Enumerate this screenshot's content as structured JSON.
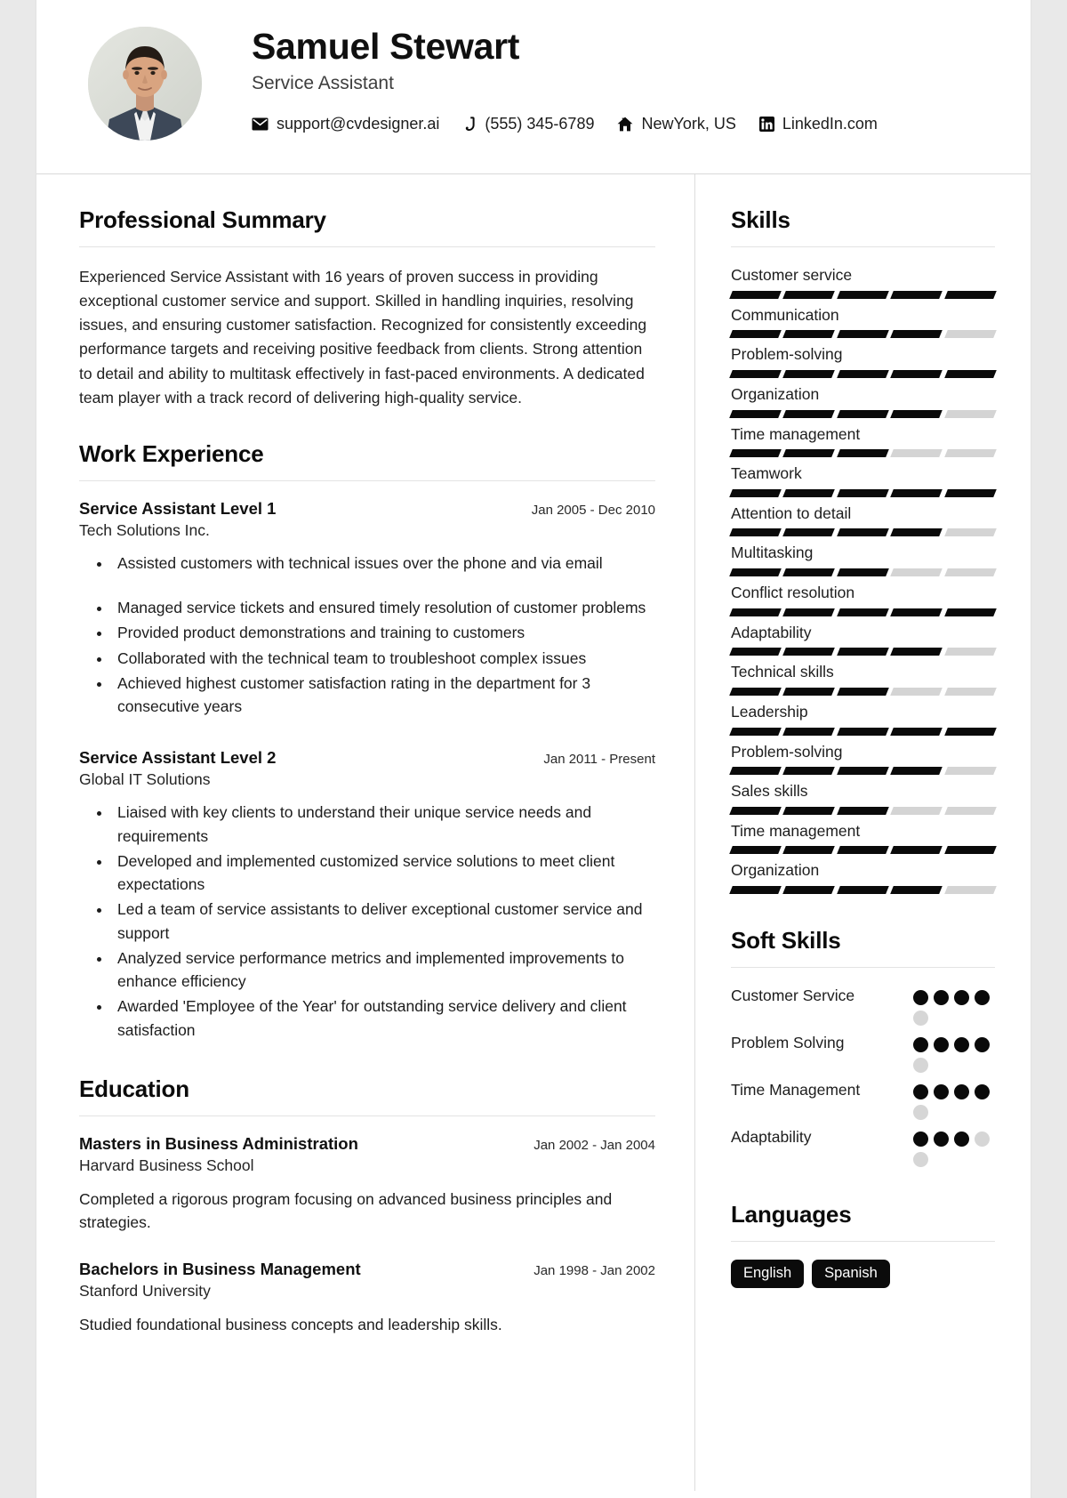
{
  "header": {
    "name": "Samuel Stewart",
    "title": "Service Assistant",
    "contacts": [
      {
        "icon": "email-icon",
        "text": "support@cvdesigner.ai"
      },
      {
        "icon": "phone-icon",
        "text": "(555) 345-6789"
      },
      {
        "icon": "home-icon",
        "text": "NewYork, US"
      },
      {
        "icon": "linkedin-icon",
        "text": "LinkedIn.com"
      }
    ]
  },
  "main": {
    "summary": {
      "heading": "Professional Summary",
      "text": "Experienced Service Assistant with 16 years of proven success in providing exceptional customer service and support. Skilled in handling inquiries, resolving issues, and ensuring customer satisfaction. Recognized for consistently exceeding performance targets and receiving positive feedback from clients. Strong attention to detail and ability to multitask effectively in fast-paced environments. A dedicated team player with a track record of delivering high-quality service."
    },
    "work": {
      "heading": "Work Experience",
      "jobs": [
        {
          "role": "Service Assistant Level 1",
          "org": "Tech Solutions Inc.",
          "date": "Jan 2005 - Dec 2010",
          "bullets": [
            "Assisted customers with technical issues over the phone and via email",
            "Managed service tickets and ensured timely resolution of customer problems",
            "Provided product demonstrations and training to customers",
            "Collaborated with the technical team to troubleshoot complex issues",
            "Achieved highest customer satisfaction rating in the department for 3 consecutive years"
          ]
        },
        {
          "role": "Service Assistant Level 2",
          "org": "Global IT Solutions",
          "date": "Jan 2011 - Present",
          "bullets": [
            "Liaised with key clients to understand their unique service needs and requirements",
            "Developed and implemented customized service solutions to meet client expectations",
            "Led a team of service assistants to deliver exceptional customer service and support",
            "Analyzed service performance metrics and implemented improvements to enhance efficiency",
            "Awarded 'Employee of the Year' for outstanding service delivery and client satisfaction"
          ]
        }
      ]
    },
    "education": {
      "heading": "Education",
      "items": [
        {
          "degree": "Masters in Business Administration",
          "school": "Harvard Business School",
          "date": "Jan 2002 - Jan 2004",
          "desc": "Completed a rigorous program focusing on advanced business principles and strategies."
        },
        {
          "degree": "Bachelors in Business Management",
          "school": "Stanford University",
          "date": "Jan 1998 - Jan 2002",
          "desc": "Studied foundational business concepts and leadership skills."
        }
      ]
    }
  },
  "sidebar": {
    "skills": {
      "heading": "Skills",
      "max": 5,
      "items": [
        {
          "label": "Customer service",
          "level": 5
        },
        {
          "label": "Communication",
          "level": 4
        },
        {
          "label": "Problem-solving",
          "level": 5
        },
        {
          "label": "Organization",
          "level": 4
        },
        {
          "label": "Time management",
          "level": 3
        },
        {
          "label": "Teamwork",
          "level": 5
        },
        {
          "label": "Attention to detail",
          "level": 4
        },
        {
          "label": "Multitasking",
          "level": 3
        },
        {
          "label": "Conflict resolution",
          "level": 5
        },
        {
          "label": "Adaptability",
          "level": 4
        },
        {
          "label": "Technical skills",
          "level": 3
        },
        {
          "label": "Leadership",
          "level": 5
        },
        {
          "label": "Problem-solving",
          "level": 4
        },
        {
          "label": "Sales skills",
          "level": 3
        },
        {
          "label": "Time management",
          "level": 5
        },
        {
          "label": "Organization",
          "level": 4
        }
      ]
    },
    "soft_skills": {
      "heading": "Soft Skills",
      "max": 5,
      "items": [
        {
          "label": "Customer Service",
          "level": 4
        },
        {
          "label": "Problem Solving",
          "level": 4
        },
        {
          "label": "Time Management",
          "level": 4
        },
        {
          "label": "Adaptability",
          "level": 3
        }
      ]
    },
    "languages": {
      "heading": "Languages",
      "items": [
        "English",
        "Spanish"
      ]
    }
  },
  "colors": {
    "accent": "#0a0a0a",
    "bar_empty": "#d4d4d4",
    "text": "#1c1c1c",
    "rule": "#e3e3e3"
  }
}
